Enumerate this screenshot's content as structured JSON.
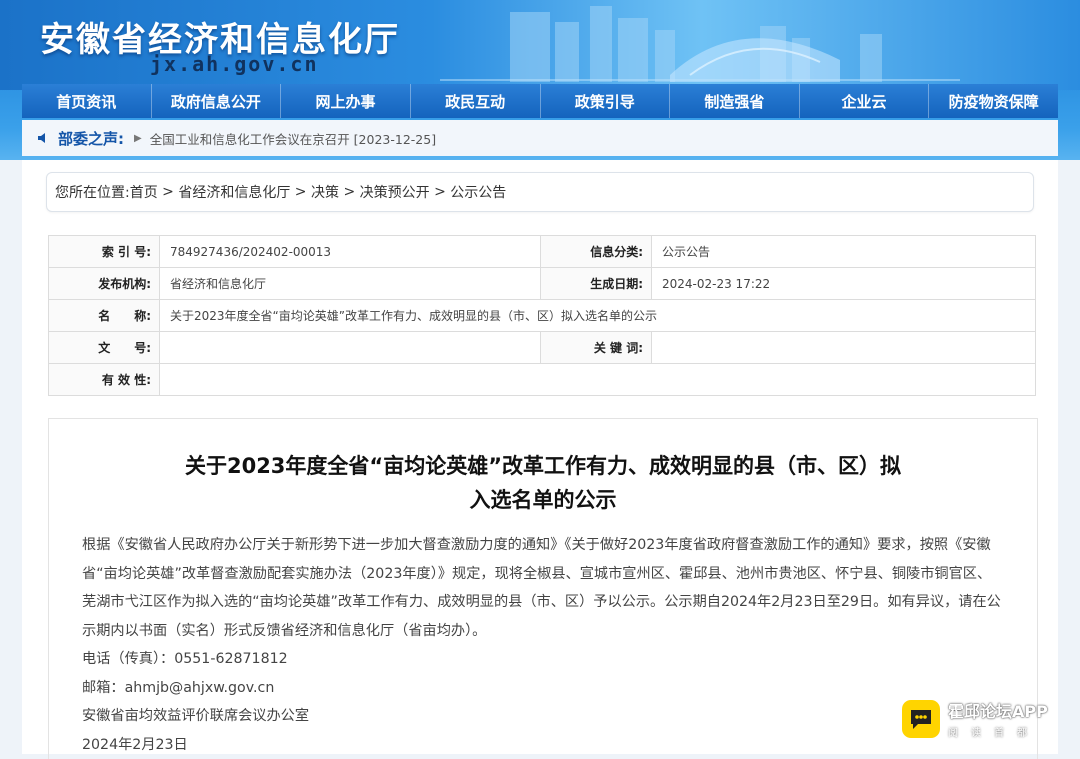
{
  "site": {
    "title": "安徽省经济和信息化厅",
    "url": "jx.ah.gov.cn"
  },
  "nav": [
    {
      "label": "首页资讯"
    },
    {
      "label": "政府信息公开"
    },
    {
      "label": "网上办事"
    },
    {
      "label": "政民互动"
    },
    {
      "label": "政策引导"
    },
    {
      "label": "制造强省"
    },
    {
      "label": "企业云"
    },
    {
      "label": "防疫物资保障"
    }
  ],
  "notice": {
    "label": "部委之声:",
    "message": "全国工业和信息化工作会议在京召开 [2023-12-25]"
  },
  "breadcrumb": {
    "prefix": "您所在位置:",
    "items": [
      "首页",
      "省经济和信息化厅",
      "决策",
      "决策预公开",
      "公示公告"
    ],
    "sep": " > "
  },
  "meta": {
    "index_label": "索 引 号:",
    "index_value": "784927436/202402-00013",
    "category_label": "信息分类:",
    "category_value": "公示公告",
    "publisher_label": "发布机构:",
    "publisher_value": "省经济和信息化厅",
    "date_label": "生成日期:",
    "date_value": "2024-02-23 17:22",
    "name_label": "名　　称:",
    "name_value": "关于2023年度全省“亩均论英雄”改革工作有力、成效明显的县（市、区）拟入选名单的公示",
    "docno_label": "文　　号:",
    "docno_value": "",
    "keywords_label": "关 键 词:",
    "keywords_value": "",
    "validity_label": "有 效 性:",
    "validity_value": ""
  },
  "article": {
    "title_line1": "关于2023年度全省“亩均论英雄”改革工作有力、成效明显的县（市、区）拟",
    "title_line2": "入选名单的公示",
    "paragraph": "根据《安徽省人民政府办公厅关于新形势下进一步加大督查激励力度的通知》《关于做好2023年度省政府督查激励工作的通知》要求，按照《安徽省“亩均论英雄”改革督查激励配套实施办法（2023年度）》规定，现将全椒县、宣城市宣州区、霍邱县、池州市贵池区、怀宁县、铜陵市铜官区、芜湖市弋江区作为拟入选的“亩均论英雄”改革工作有力、成效明显的县（市、区）予以公示。公示期自2024年2月23日至29日。如有异议，请在公示期内以书面（实名）形式反馈省经济和信息化厅（省亩均办）。",
    "phone": "电话（传真）：0551-62871812",
    "email": "邮箱：ahmjb@ahjxw.gov.cn",
    "signature": "安徽省亩均效益评价联席会议办公室",
    "date": "2024年2月23日"
  },
  "watermark": {
    "name": "霍邱论坛APP",
    "sub": "阅读首都"
  },
  "colors": {
    "nav_bg": "#1463bd",
    "header_blue": "#2a8fe0",
    "label_blue": "#1455a8",
    "logo_yellow": "#ffd400"
  }
}
